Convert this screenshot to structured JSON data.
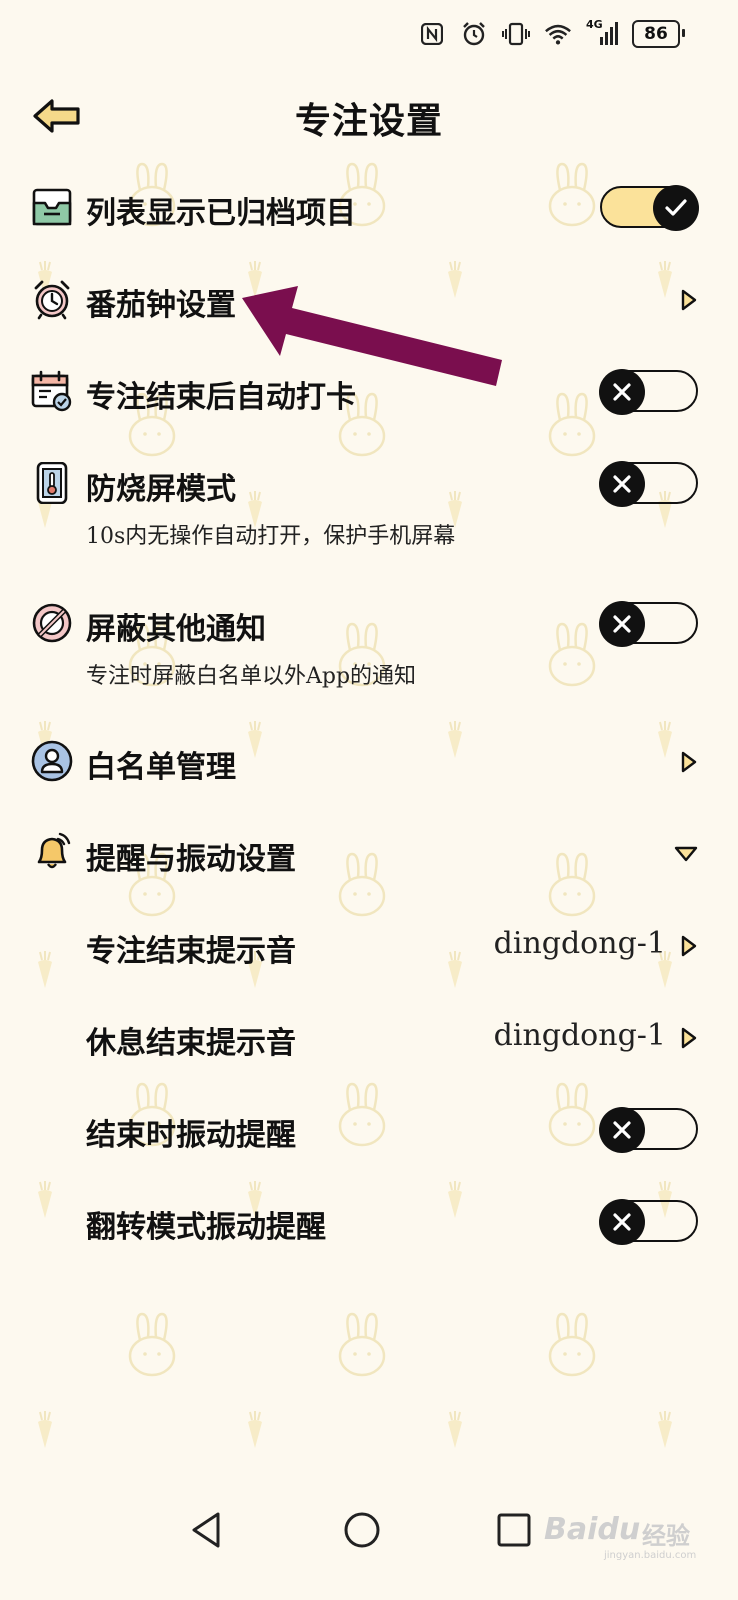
{
  "status_bar": {
    "network_label": "4G",
    "battery_level": "86",
    "icons": [
      "nfc-icon",
      "alarm-icon",
      "vibrate-icon",
      "wifi-icon",
      "cell-signal-icon",
      "battery-icon"
    ]
  },
  "header": {
    "title": "专注设置",
    "back_icon": "back-arrow-icon"
  },
  "settings": {
    "archived": {
      "label": "列表显示已归档项目",
      "enabled": true,
      "icon": "archive-box-icon"
    },
    "pomodoro": {
      "label": "番茄钟设置",
      "icon": "alarm-clock-icon"
    },
    "auto_checkin": {
      "label": "专注结束后自动打卡",
      "enabled": false,
      "icon": "calendar-check-icon"
    },
    "burn_in": {
      "label": "防烧屏模式",
      "desc": "10s内无操作自动打开，保护手机屏幕",
      "enabled": false,
      "icon": "phone-thermometer-icon"
    },
    "block_notif": {
      "label": "屏蔽其他通知",
      "desc": "专注时屏蔽白名单以外App的通知",
      "enabled": false,
      "icon": "block-icon"
    },
    "whitelist": {
      "label": "白名单管理",
      "icon": "user-icon"
    },
    "reminder": {
      "label": "提醒与振动设置",
      "expanded": true,
      "icon": "bell-icon"
    },
    "focus_end_sound": {
      "label": "专注结束提示音",
      "value": "dingdong-1"
    },
    "break_end_sound": {
      "label": "休息结束提示音",
      "value": "dingdong-1"
    },
    "end_vibrate": {
      "label": "结束时振动提醒",
      "enabled": false
    },
    "flip_vibrate": {
      "label": "翻转模式振动提醒",
      "enabled": false
    }
  },
  "watermark": {
    "brand": "Baidu",
    "suffix": "经验",
    "url": "jingyan.baidu.com"
  },
  "colors": {
    "background": "#fdf9ef",
    "toggle_on": "#fbe29a",
    "accent_yellow": "#f5d98a",
    "annotation": "#7a0e4e"
  }
}
